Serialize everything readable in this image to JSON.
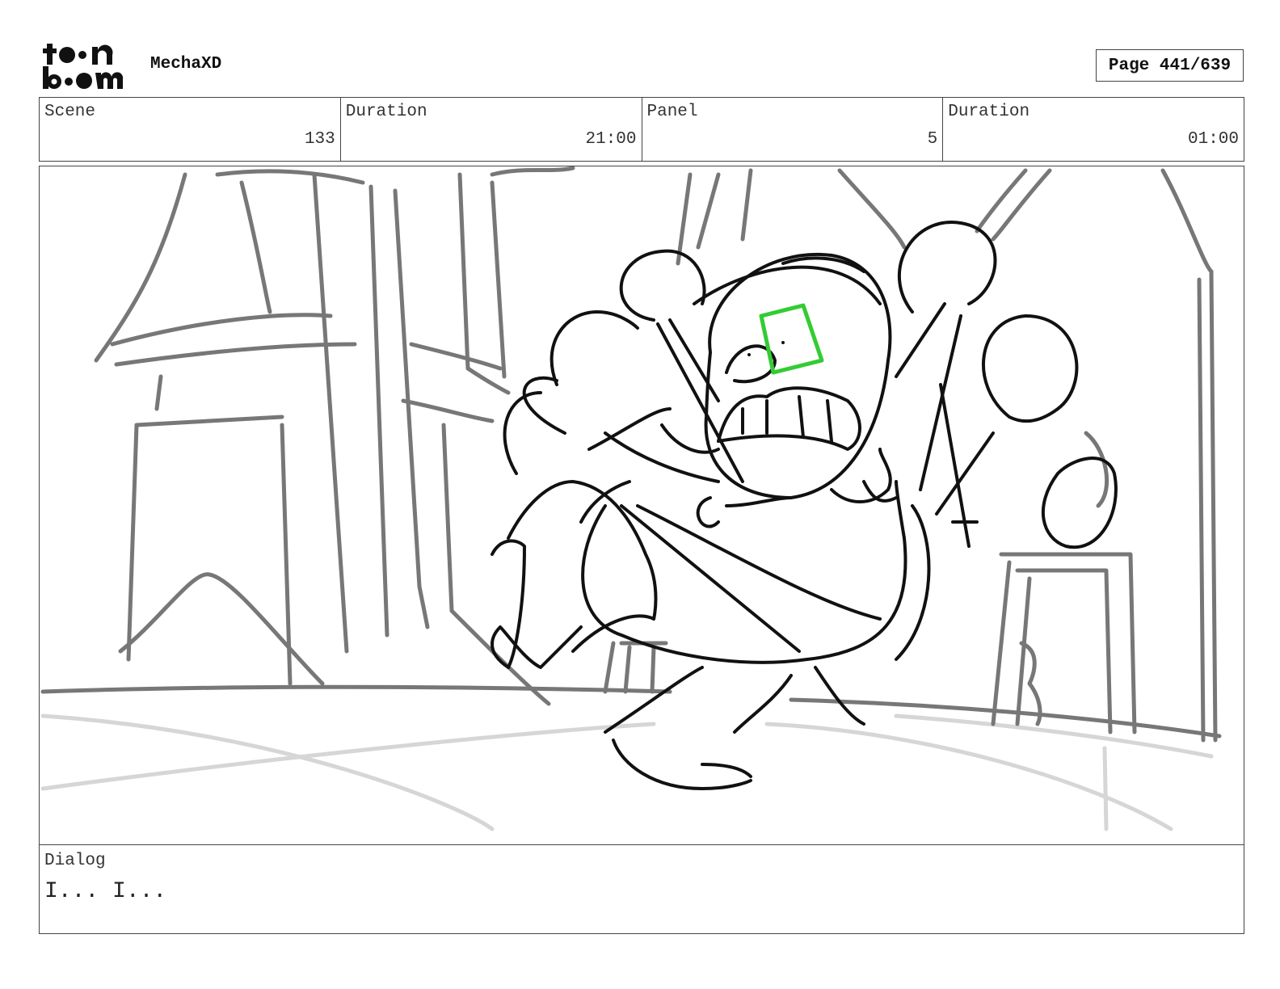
{
  "header": {
    "logo_text": "toon boom",
    "project_title": "MechaXD",
    "page_label": "Page 441/639"
  },
  "info": {
    "scene": {
      "label": "Scene",
      "value": "133"
    },
    "scene_duration": {
      "label": "Duration",
      "value": "21:00"
    },
    "panel": {
      "label": "Panel",
      "value": "5"
    },
    "panel_duration": {
      "label": "Duration",
      "value": "01:00"
    }
  },
  "dialog": {
    "label": "Dialog",
    "text": "I... I..."
  },
  "colors": {
    "border": "#444444",
    "sketch_dark": "#111111",
    "sketch_mid": "#777777",
    "sketch_light": "#d6d6d6",
    "highlight": "#33cc33"
  }
}
